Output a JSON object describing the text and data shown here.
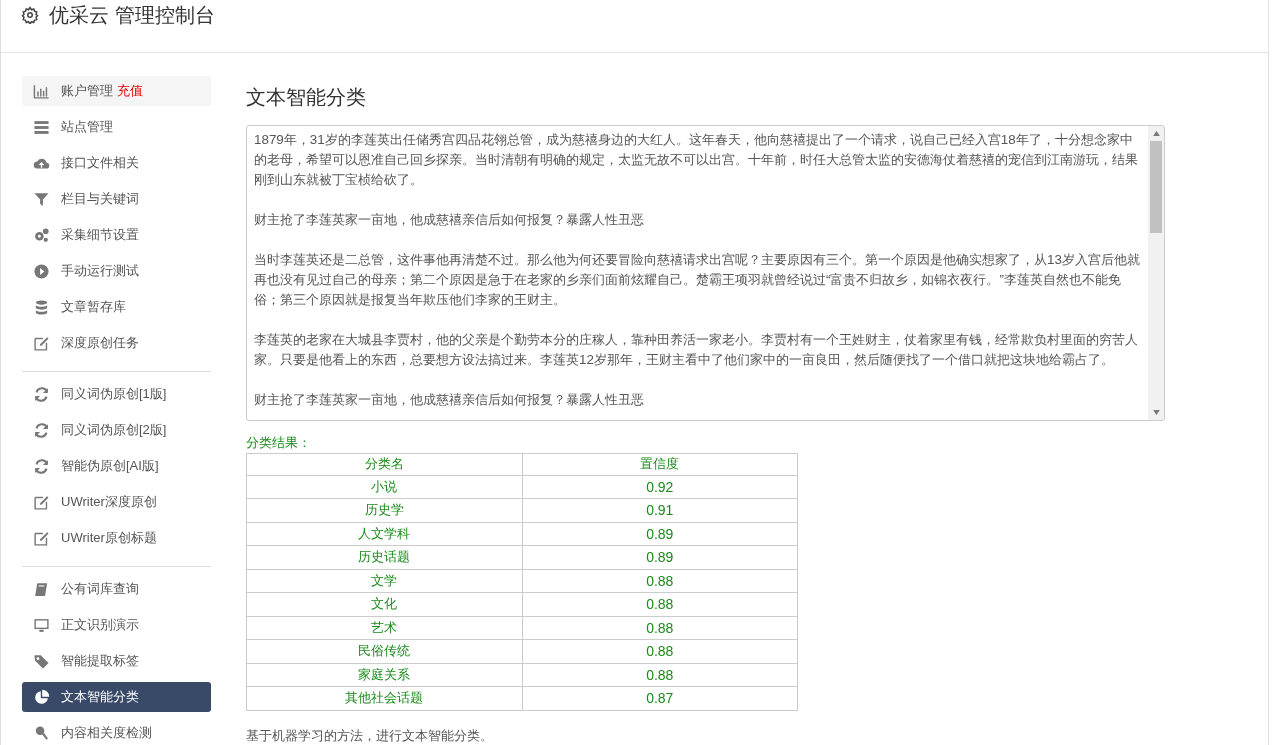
{
  "header": {
    "title": "优采云 管理控制台"
  },
  "sidebar": {
    "groups": [
      {
        "items": [
          {
            "label": "账户管理",
            "badge": "充值",
            "selected": false
          },
          {
            "label": "站点管理",
            "selected": false
          },
          {
            "label": "接口文件相关",
            "selected": false
          },
          {
            "label": "栏目与关键词",
            "selected": false
          },
          {
            "label": "采集细节设置",
            "selected": false
          },
          {
            "label": "手动运行测试",
            "selected": false
          },
          {
            "label": "文章暂存库",
            "selected": false
          },
          {
            "label": "深度原创任务",
            "selected": false
          }
        ]
      },
      {
        "items": [
          {
            "label": "同义词伪原创[1版]",
            "selected": false
          },
          {
            "label": "同义词伪原创[2版]",
            "selected": false
          },
          {
            "label": "智能伪原创[AI版]",
            "selected": false
          },
          {
            "label": "UWriter深度原创",
            "selected": false
          },
          {
            "label": "UWriter原创标题",
            "selected": false
          }
        ]
      },
      {
        "items": [
          {
            "label": "公有词库查询",
            "selected": false
          },
          {
            "label": "正文识别演示",
            "selected": false
          },
          {
            "label": "智能提取标签",
            "selected": false
          },
          {
            "label": "文本智能分类",
            "selected": true
          },
          {
            "label": "内容相关度检测",
            "selected": false
          }
        ]
      }
    ]
  },
  "main": {
    "heading": "文本智能分类",
    "input_text": [
      "1879年，31岁的李莲英出任储秀宫四品花翎总管，成为慈禧身边的大红人。这年春天，他向慈禧提出了一个请求，说自己已经入宫18年了，十分想念家中的老母，希望可以恩准自己回乡探亲。当时清朝有明确的规定，太监无故不可以出宫。十年前，时任大总管太监的安德海仗着慈禧的宠信到江南游玩，结果刚到山东就被丁宝桢给砍了。",
      "财主抢了李莲英家一亩地，他成慈禧亲信后如何报复？暴露人性丑恶",
      "当时李莲英还是二总管，这件事他再清楚不过。那么他为何还要冒险向慈禧请求出宫呢？主要原因有三个。第一个原因是他确实想家了，从13岁入宫后他就再也没有见过自己的母亲；第二个原因是急于在老家的乡亲们面前炫耀自己。楚霸王项羽就曾经说过“富贵不归故乡，如锦衣夜行。”李莲英自然也不能免俗；第三个原因就是报复当年欺压他们李家的王财主。",
      "李莲英的老家在大城县李贾村，他的父亲是个勤劳本分的庄稼人，靠种田养活一家老小。李贾村有一个王姓财主，仗着家里有钱，经常欺负村里面的穷苦人家。只要是他看上的东西，总要想方设法搞过来。李莲英12岁那年，王财主看中了他们家中的一亩良田，然后随便找了一个借口就把这块地给霸占了。",
      "财主抢了李莲英家一亩地，他成慈禧亲信后如何报复？暴露人性丑恶"
    ],
    "result_label": "分类结果：",
    "table": {
      "columns": [
        "分类名",
        "置信度"
      ],
      "rows": [
        [
          "小说",
          "0.92"
        ],
        [
          "历史学",
          "0.91"
        ],
        [
          "人文学科",
          "0.89"
        ],
        [
          "历史话题",
          "0.89"
        ],
        [
          "文学",
          "0.88"
        ],
        [
          "文化",
          "0.88"
        ],
        [
          "艺术",
          "0.88"
        ],
        [
          "民俗传统",
          "0.88"
        ],
        [
          "家庭关系",
          "0.88"
        ],
        [
          "其他社会话题",
          "0.87"
        ]
      ]
    },
    "footnote": "基于机器学习的方法，进行文本智能分类。"
  }
}
